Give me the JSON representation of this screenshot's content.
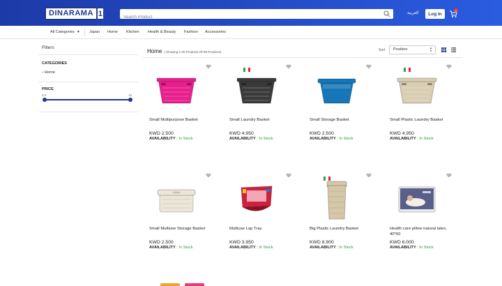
{
  "header": {
    "logo_text": "DINARAMA",
    "logo_badge": "1",
    "search_placeholder": "Search Product",
    "language": "العربية",
    "login_label": "Log In",
    "cart_count": "0"
  },
  "nav": {
    "items": [
      "All Categories",
      "Japan",
      "Home",
      "Kitchen",
      "Health & Beauty",
      "Fashion",
      "Accessories"
    ]
  },
  "sidebar": {
    "filters_title": "Filters",
    "categories_title": "CATEGORIES",
    "category_home": "Home",
    "price_title": "PRICE",
    "price_min": "0.5",
    "price_max": "18"
  },
  "toolbar": {
    "crumb": "Home",
    "count_text": "( Showing 1-20 Products Of 99 Products)",
    "sort_label": "Sort",
    "sort_value": "Position"
  },
  "product_labels": {
    "availability": "AVAILABILITY",
    "in_stock": "In Stock"
  },
  "products": [
    {
      "name": "Small Multipurpose Basket",
      "price": "KWD 2.500",
      "color": "#e8208e",
      "flag": false,
      "kind": "basket"
    },
    {
      "name": "Small Laundry Basket",
      "price": "KWD 4.950",
      "color": "#3a3a3a",
      "flag": true,
      "kind": "basket"
    },
    {
      "name": "Small Storage Basket",
      "price": "KWD 2.500",
      "color": "#1676b8",
      "flag": false,
      "kind": "tub"
    },
    {
      "name": "Small Plastic Laundry Basket",
      "price": "KWD 4.950",
      "color": "#d9cdb3",
      "flag": true,
      "kind": "basket"
    },
    {
      "name": "Small Multiuse Storage Basket",
      "price": "KWD 2.500",
      "color": "#ece6d8",
      "flag": false,
      "kind": "lidbox"
    },
    {
      "name": "Multiuse Lap Tray",
      "price": "KWD 3.950",
      "color": "#d1203e",
      "flag": false,
      "kind": "tray"
    },
    {
      "name": "Big Plastic Laundry Basket",
      "price": "KWD 8.900",
      "color": "#d6c7a8",
      "flag": true,
      "kind": "hamper"
    },
    {
      "name": "Health care pillow natural latex, 40*60",
      "price": "KWD 6.000",
      "color": "#5a5f8a",
      "flag": false,
      "kind": "pillow"
    }
  ]
}
